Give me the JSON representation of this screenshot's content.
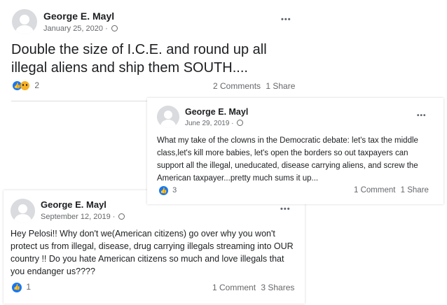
{
  "post1": {
    "author": "George E. Mayl",
    "date": "January 25, 2020",
    "separator": "·",
    "text": "Double the size of I.C.E. and round up all illegal aliens and ship them SOUTH....",
    "reaction_count": "2",
    "comments": "2 Comments",
    "shares": "1 Share",
    "more": "•••"
  },
  "post2": {
    "author": "George E. Mayl",
    "date": "June 29, 2019",
    "separator": "·",
    "text": "What my take of the clowns in the Democratic debate: let's tax the middle class,let's kill more babies, let's open the borders so out taxpayers can support all the illegal, uneducated, disease carrying aliens, and screw the American taxpayer...pretty much sums it up...",
    "reaction_count": "3",
    "comments": "1 Comment",
    "shares": "1 Share",
    "more": "•••"
  },
  "post3": {
    "author": "George E. Mayl",
    "date": "September 12, 2019",
    "separator": "·",
    "text": "Hey Pelosi!! Why don't we(American citizens) go over why you won't protect us from illegal, disease, drug carrying illegals streaming into OUR country !! Do you hate American citizens so much and love illegals that you endanger us????",
    "reaction_count": "1",
    "comments": "1 Comment",
    "shares": "3 Shares",
    "more": "•••"
  },
  "colors": {
    "like_blue": "#1877f2",
    "wow_yellow": "#f7b125",
    "meta_gray": "#65676b"
  },
  "icons": [
    "avatar-placeholder",
    "globe-icon",
    "like-icon",
    "wow-icon",
    "more-options-icon"
  ]
}
